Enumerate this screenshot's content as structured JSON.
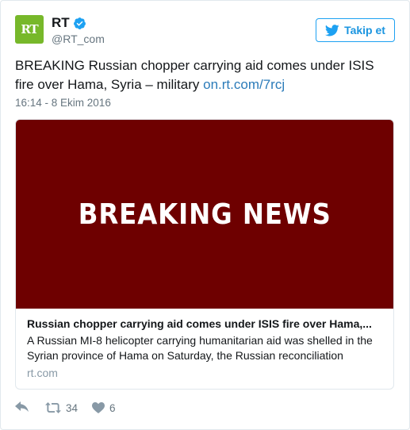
{
  "user": {
    "avatar_text": "RT",
    "display_name": "RT",
    "handle": "@RT_com",
    "verified": true
  },
  "follow_button": {
    "label": "Takip et"
  },
  "tweet": {
    "text": "BREAKING Russian chopper carrying aid comes under ISIS fire over Hama, Syria – military ",
    "link_text": "on.rt.com/7rcj",
    "timestamp": "16:14 - 8 Ekim 2016"
  },
  "card": {
    "image_text": "BREAKING NEWS",
    "title": "Russian chopper carrying aid comes under ISIS fire over Hama,...",
    "description": "A Russian MI-8 helicopter carrying humanitarian aid was shelled in the Syrian province of Hama on Saturday, the Russian reconciliation",
    "domain": "rt.com"
  },
  "actions": {
    "retweet_count": "34",
    "like_count": "6"
  },
  "colors": {
    "brand_green": "#77b82a",
    "link_blue": "#2b7bb9",
    "image_bg": "#6e0000",
    "muted_gray": "#8899a6"
  },
  "icons": {
    "reply": "reply-icon",
    "retweet": "retweet-icon",
    "like": "heart-icon",
    "verified": "verified-badge-icon",
    "twitter_bird": "twitter-bird-icon"
  }
}
